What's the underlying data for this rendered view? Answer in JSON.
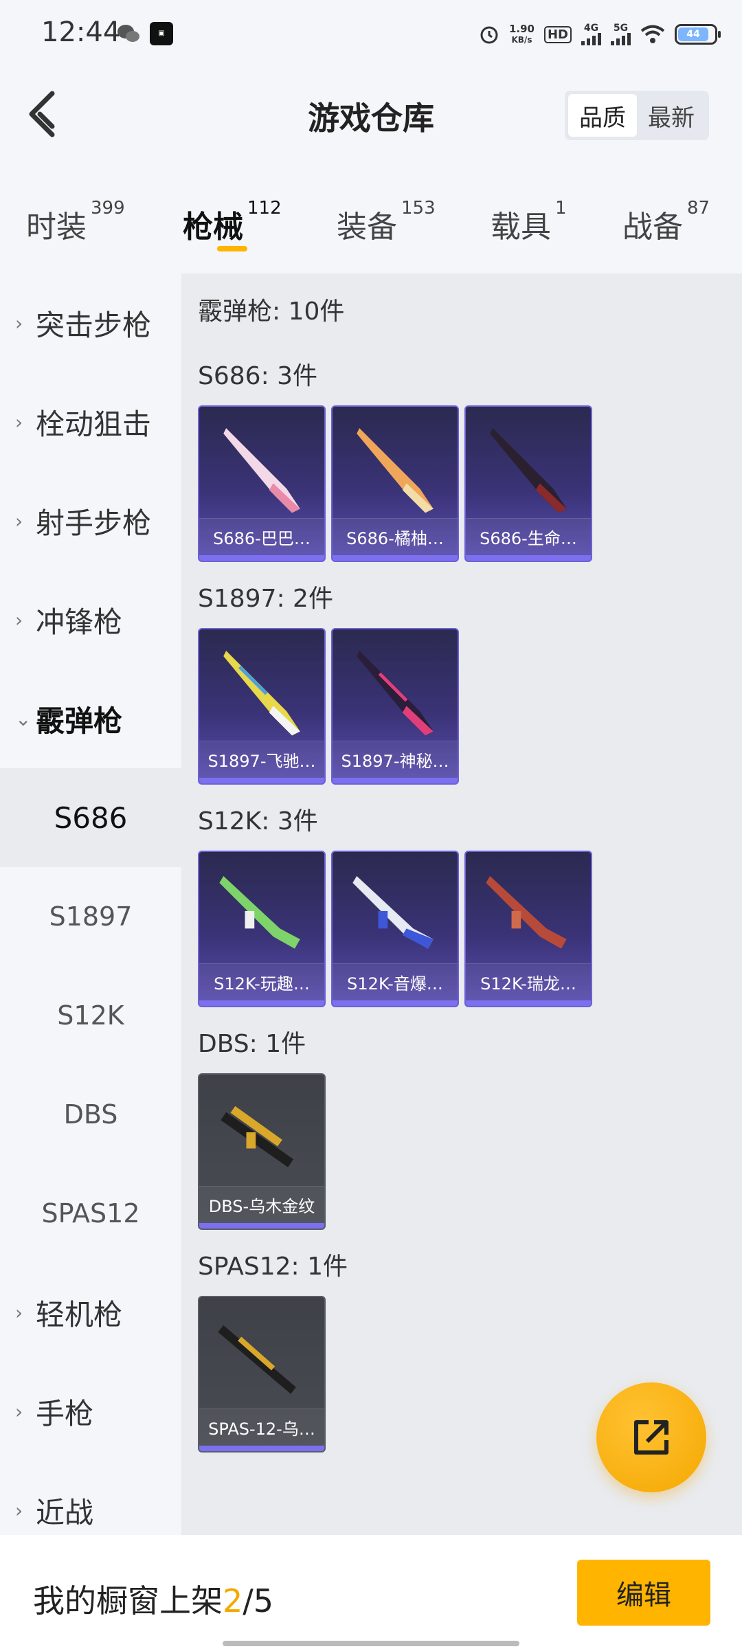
{
  "status_bar": {
    "time": "12:44",
    "speed_top": "1.90",
    "speed_bottom": "KB/s",
    "hd": "HD",
    "net1": "4G",
    "net2": "5G",
    "battery": "44"
  },
  "header": {
    "title": "游戏仓库",
    "sort_options": [
      "品质",
      "最新"
    ],
    "sort_selected": "品质"
  },
  "tabs": [
    {
      "label": "时装",
      "count": "399"
    },
    {
      "label": "枪械",
      "count": "112",
      "active": true
    },
    {
      "label": "装备",
      "count": "153"
    },
    {
      "label": "载具",
      "count": "1"
    },
    {
      "label": "战备",
      "count": "87"
    }
  ],
  "sidebar": {
    "categories": [
      {
        "label": "突击步枪"
      },
      {
        "label": "栓动狙击"
      },
      {
        "label": "射手步枪"
      },
      {
        "label": "冲锋枪"
      },
      {
        "label": "霰弹枪",
        "open": true
      }
    ],
    "subs": [
      {
        "label": "S686",
        "active": true
      },
      {
        "label": "S1897"
      },
      {
        "label": "S12K"
      },
      {
        "label": "DBS"
      },
      {
        "label": "SPAS12"
      }
    ],
    "more_categories": [
      {
        "label": "轻机枪"
      },
      {
        "label": "手枪"
      },
      {
        "label": "近战"
      }
    ]
  },
  "main": {
    "summary": "霰弹枪: 10件",
    "sections": [
      {
        "title": "S686: 3件",
        "items": [
          "S686-巴巴…",
          "S686-橘柚…",
          "S686-生命…"
        ]
      },
      {
        "title": "S1897: 2件",
        "items": [
          "S1897-飞驰…",
          "S1897-神秘…"
        ]
      },
      {
        "title": "S12K: 3件",
        "items": [
          "S12K-玩趣…",
          "S12K-音爆…",
          "S12K-瑞龙…"
        ]
      },
      {
        "title": "DBS: 1件",
        "items": [
          "DBS-乌木金纹"
        ]
      },
      {
        "title": "SPAS12: 1件",
        "items": [
          "SPAS-12-乌…"
        ]
      }
    ]
  },
  "bottom": {
    "shelf_prefix": "我的橱窗上架",
    "shelf_current": "2",
    "shelf_total": "/5",
    "edit_label": "编辑"
  },
  "colors": {
    "accent": "#ffb400",
    "purple_card": "#3a3377",
    "gray_card": "#45474f"
  },
  "icons": {
    "back": "chevron-left-icon",
    "share": "external-link-icon"
  }
}
